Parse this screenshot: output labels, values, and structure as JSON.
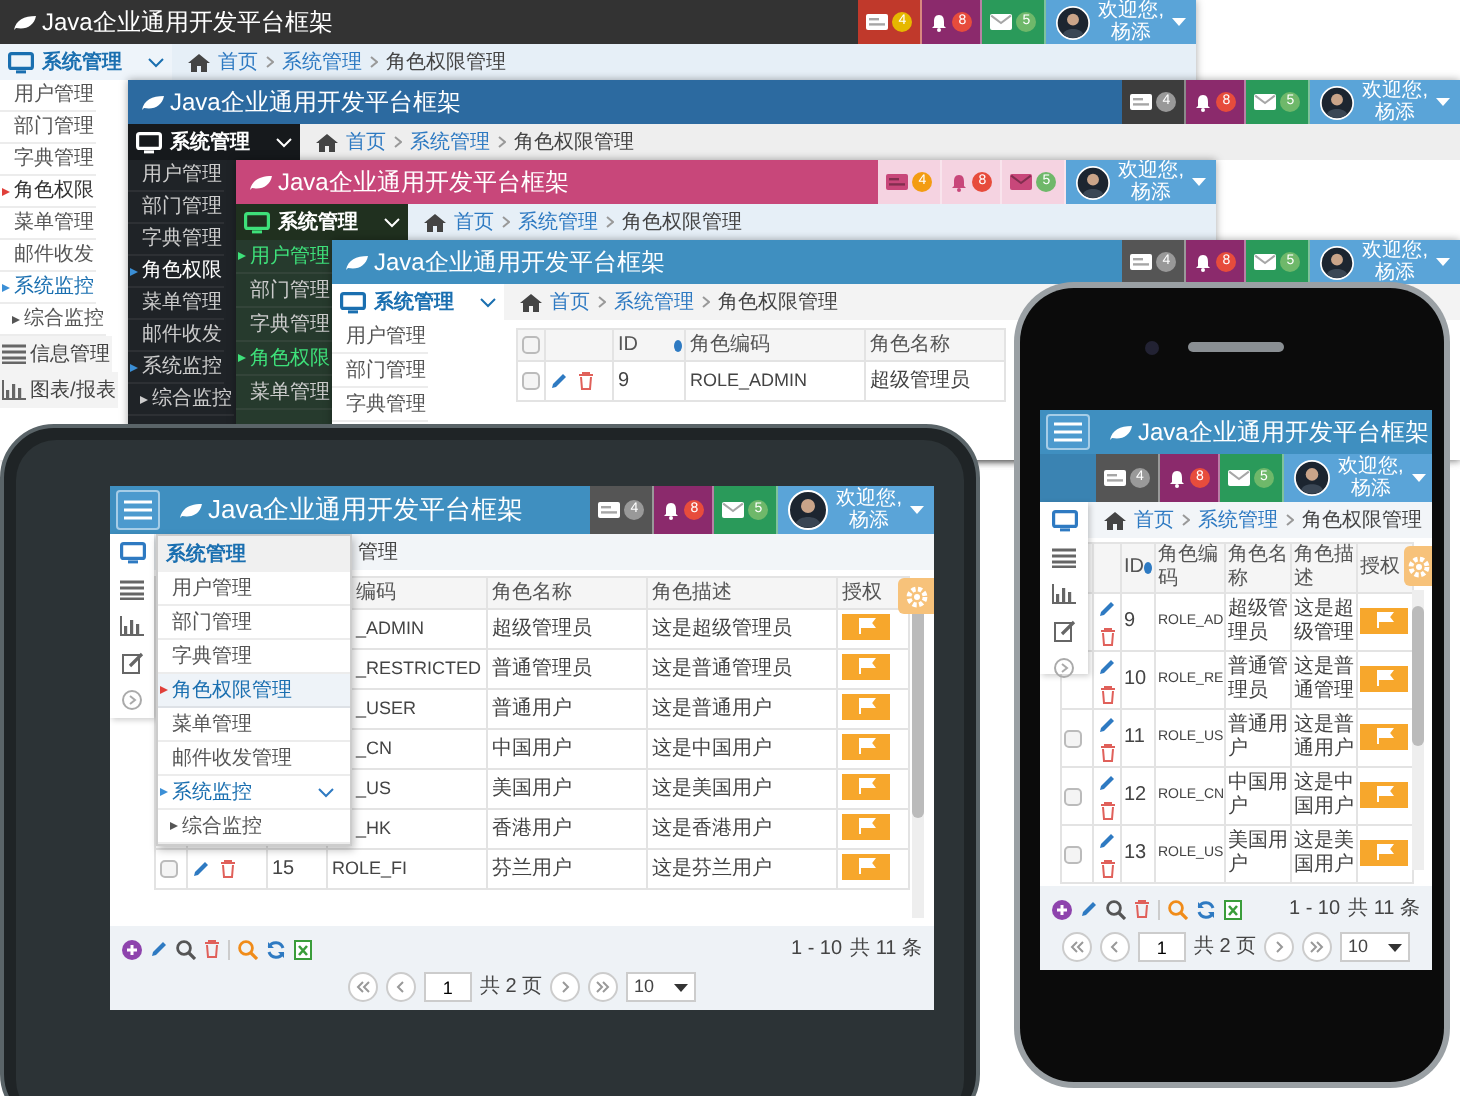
{
  "windows": [
    {
      "title": "Java企业通用开发平台框架",
      "badges": [
        {
          "count": "4"
        },
        {
          "count": "8"
        },
        {
          "count": "5"
        }
      ],
      "user": {
        "greeting": "欢迎您,",
        "name": "杨添"
      },
      "breadcrumb": [
        "首页",
        "系统管理",
        "角色权限管理"
      ],
      "menu": {
        "title": "系统管理",
        "expanded": true,
        "items": [
          {
            "label": "用户管理",
            "kind": "item",
            "selected": false
          },
          {
            "label": "部门管理",
            "kind": "item",
            "selected": false
          },
          {
            "label": "字典管理",
            "kind": "item",
            "selected": false
          },
          {
            "label": "角色权限",
            "kind": "item",
            "selected": true
          },
          {
            "label": "菜单管理",
            "kind": "item",
            "selected": false
          },
          {
            "label": "邮件收发",
            "kind": "item",
            "selected": false
          },
          {
            "label": "系统监控",
            "kind": "group",
            "selected": false
          },
          {
            "label": "综合监控",
            "kind": "sub",
            "selected": false
          }
        ]
      },
      "modules": [
        {
          "label": "信息管理"
        },
        {
          "label": "图表/报表"
        }
      ]
    },
    {
      "title": "Java企业通用开发平台框架",
      "badges": [
        {
          "count": "4"
        },
        {
          "count": "8"
        },
        {
          "count": "5"
        }
      ],
      "user": {
        "greeting": "欢迎您,",
        "name": "杨添"
      },
      "breadcrumb": [
        "首页",
        "系统管理",
        "角色权限管理"
      ],
      "menu": {
        "title": "系统管理",
        "expanded": true,
        "items": [
          {
            "label": "用户管理",
            "kind": "item",
            "selected": false
          },
          {
            "label": "部门管理",
            "kind": "item",
            "selected": false
          },
          {
            "label": "字典管理",
            "kind": "item",
            "selected": false
          },
          {
            "label": "角色权限",
            "kind": "item",
            "selected": true
          },
          {
            "label": "菜单管理",
            "kind": "item",
            "selected": false
          },
          {
            "label": "邮件收发",
            "kind": "item",
            "selected": false
          },
          {
            "label": "系统监控",
            "kind": "group",
            "selected": false
          },
          {
            "label": "综合监控",
            "kind": "sub",
            "selected": false
          }
        ]
      }
    },
    {
      "title": "Java企业通用开发平台框架",
      "badges": [
        {
          "count": "4"
        },
        {
          "count": "8"
        },
        {
          "count": "5"
        }
      ],
      "user": {
        "greeting": "欢迎您,",
        "name": "杨添"
      },
      "breadcrumb": [
        "首页",
        "系统管理",
        "角色权限管理"
      ],
      "menu": {
        "title": "系统管理",
        "expanded": true,
        "items": [
          {
            "label": "用户管理",
            "kind": "item",
            "selected": true
          },
          {
            "label": "部门管理",
            "kind": "item",
            "selected": false
          },
          {
            "label": "字典管理",
            "kind": "item",
            "selected": false
          },
          {
            "label": "角色权限",
            "kind": "item",
            "selected": true
          },
          {
            "label": "菜单管理",
            "kind": "item",
            "selected": false
          }
        ]
      }
    },
    {
      "title": "Java企业通用开发平台框架",
      "badges": [
        {
          "count": "4"
        },
        {
          "count": "8"
        },
        {
          "count": "5"
        }
      ],
      "user": {
        "greeting": "欢迎您,",
        "name": "杨添"
      },
      "breadcrumb": [
        "首页",
        "系统管理",
        "角色权限管理"
      ],
      "menu": {
        "title": "系统管理",
        "expanded": true,
        "items": [
          {
            "label": "用户管理",
            "kind": "item",
            "selected": false
          },
          {
            "label": "部门管理",
            "kind": "item",
            "selected": false
          },
          {
            "label": "字典管理",
            "kind": "item",
            "selected": false
          }
        ]
      },
      "table": {
        "checked": false,
        "columns": {
          "id": "ID",
          "code": "角色编码",
          "name": "角色名称"
        },
        "rows": [
          {
            "id": "9",
            "code": "ROLE_ADMIN",
            "name": "超级管理员",
            "checked": false
          }
        ]
      }
    }
  ],
  "tablet": {
    "title": "Java企业通用开发平台框架",
    "badges": [
      {
        "count": "4"
      },
      {
        "count": "8"
      },
      {
        "count": "5"
      }
    ],
    "user": {
      "greeting": "欢迎您,",
      "name": "杨添"
    },
    "breadcrumb": [
      "管理"
    ],
    "dropdown": {
      "title": "系统管理",
      "items": [
        {
          "label": "用户管理",
          "kind": "item",
          "selected": false
        },
        {
          "label": "部门管理",
          "kind": "item",
          "selected": false
        },
        {
          "label": "字典管理",
          "kind": "item",
          "selected": false
        },
        {
          "label": "角色权限管理",
          "kind": "item",
          "selected": true
        },
        {
          "label": "菜单管理",
          "kind": "item",
          "selected": false
        },
        {
          "label": "邮件收发管理",
          "kind": "item",
          "selected": false
        },
        {
          "label": "系统监控",
          "kind": "group",
          "selected": false
        },
        {
          "label": "综合监控",
          "kind": "sub",
          "selected": false
        }
      ]
    },
    "table": {
      "columns": {
        "code": "编码",
        "name": "角色名称",
        "desc": "角色描述",
        "grant": "授权"
      },
      "rows": [
        {
          "code": "_ADMIN",
          "name": "超级管理员",
          "desc": "这是超级管理员"
        },
        {
          "code": "_RESTRICTED",
          "name": "普通管理员",
          "desc": "这是普通管理员"
        },
        {
          "code": "_USER",
          "name": "普通用户",
          "desc": "这是普通用户"
        },
        {
          "code": "_CN",
          "name": "中国用户",
          "desc": "这是中国用户"
        },
        {
          "code": "_US",
          "name": "美国用户",
          "desc": "这是美国用户"
        },
        {
          "code": "_HK",
          "name": "香港用户",
          "desc": "这是香港用户"
        },
        {
          "id": "15",
          "code": "ROLE_FI",
          "name": "芬兰用户",
          "desc": "这是芬兰用户",
          "checked": false
        }
      ]
    },
    "footer": {
      "range": "1 - 10",
      "total": "共 11 条",
      "page": "1",
      "pages": "共 2 页",
      "page_size": "10"
    }
  },
  "phone": {
    "title": "Java企业通用开发平台框架",
    "badges": [
      {
        "count": "4"
      },
      {
        "count": "8"
      },
      {
        "count": "5"
      }
    ],
    "user": {
      "greeting": "欢迎您,",
      "name": "杨添"
    },
    "breadcrumb": [
      "首页",
      "系统管理",
      "角色权限管理"
    ],
    "table": {
      "columns": {
        "id": "ID",
        "code": "角色编码",
        "name": "角色名称",
        "desc": "角色描述",
        "grant": "授权"
      },
      "rows": [
        {
          "id": "9",
          "code": "ROLE_AD",
          "name": "超级管理员",
          "desc": "这是超级管理"
        },
        {
          "id": "10",
          "code": "ROLE_RE",
          "name": "普通管理员",
          "desc": "这是普通管理"
        },
        {
          "id": "11",
          "code": "ROLE_US",
          "name": "普通用户",
          "desc": "这是普通用户",
          "checked": false
        },
        {
          "id": "12",
          "code": "ROLE_CN",
          "name": "中国用户",
          "desc": "这是中国用户",
          "checked": false
        },
        {
          "id": "13",
          "code": "ROLE_US",
          "name": "美国用户",
          "desc": "这是美国用户",
          "checked": false
        }
      ]
    },
    "footer": {
      "range": "1 - 10",
      "total": "共 11 条",
      "page": "1",
      "pages": "共 2 页",
      "page_size": "10"
    }
  }
}
